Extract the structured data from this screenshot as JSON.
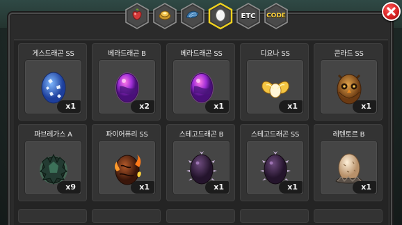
{
  "tabs": [
    {
      "name": "fruit-tab-icon",
      "kind": "icon",
      "active": false
    },
    {
      "name": "gold-tab-icon",
      "kind": "icon",
      "active": false
    },
    {
      "name": "shell-tab-icon",
      "kind": "icon",
      "active": false
    },
    {
      "name": "egg-tab-icon",
      "kind": "icon",
      "active": true
    },
    {
      "name": "tab-etc",
      "kind": "text",
      "label": "ETC",
      "active": false
    },
    {
      "name": "tab-code",
      "kind": "text",
      "label": "CODE",
      "active": false
    }
  ],
  "colors": {
    "active_tab_border": "#f1d21e",
    "tab_border": "#8e8e8e",
    "close_button": "#d21f1f"
  },
  "items": [
    {
      "name": "게스드래곤 SS",
      "qty": "x1",
      "egg": "blue-spotted-egg"
    },
    {
      "name": "베라드래곤 B",
      "qty": "x2",
      "egg": "purple-pink-egg"
    },
    {
      "name": "베라드래곤 SS",
      "qty": "x1",
      "egg": "purple-pink-egg"
    },
    {
      "name": "디요나 SS",
      "qty": "x1",
      "egg": "gold-winged-egg"
    },
    {
      "name": "콘라드 SS",
      "qty": "x1",
      "egg": "owl-egg"
    },
    {
      "name": "파브레가스 A",
      "qty": "x9",
      "egg": "dark-green-spiky-egg"
    },
    {
      "name": "파이어퓨리 SS",
      "qty": "x1",
      "egg": "fire-egg"
    },
    {
      "name": "스테고드래곤 B",
      "qty": "x1",
      "egg": "dark-purple-spiked-egg"
    },
    {
      "name": "스테고드래곤 SS",
      "qty": "x1",
      "egg": "dark-purple-spiked-egg"
    },
    {
      "name": "레텐토르 B",
      "qty": "x1",
      "egg": "tan-nest-egg"
    }
  ]
}
